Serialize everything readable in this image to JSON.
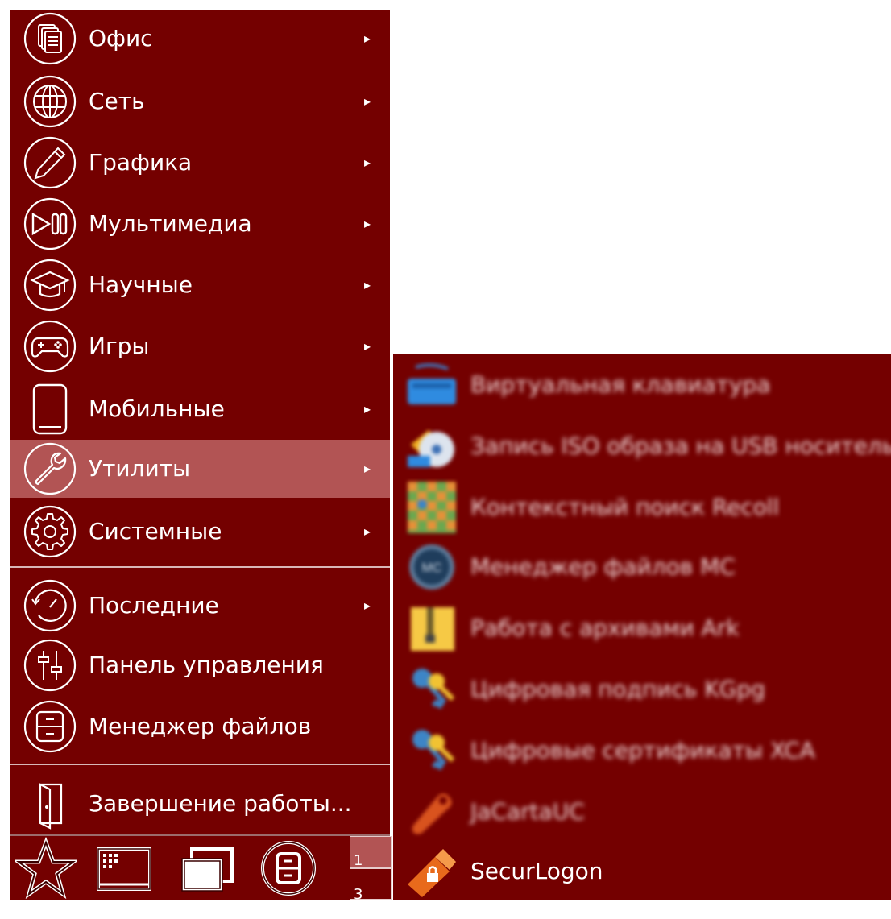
{
  "menu": {
    "items": [
      {
        "label": "Офис",
        "icon": "documents-icon",
        "has_submenu": true
      },
      {
        "label": "Сеть",
        "icon": "globe-icon",
        "has_submenu": true
      },
      {
        "label": "Графика",
        "icon": "pencil-icon",
        "has_submenu": true
      },
      {
        "label": "Мультимедиа",
        "icon": "play-pause-icon",
        "has_submenu": true
      },
      {
        "label": "Научные",
        "icon": "graduation-cap-icon",
        "has_submenu": true
      },
      {
        "label": "Игры",
        "icon": "gamepad-icon",
        "has_submenu": true
      },
      {
        "label": "Мобильные",
        "icon": "tablet-icon",
        "has_submenu": true
      },
      {
        "label": "Утилиты",
        "icon": "wrench-icon",
        "has_submenu": true,
        "active": true
      },
      {
        "label": "Системные",
        "icon": "gear-icon",
        "has_submenu": true
      }
    ],
    "items2": [
      {
        "label": "Последние",
        "icon": "clock-icon",
        "has_submenu": true
      },
      {
        "label": "Панель управления",
        "icon": "sliders-icon",
        "has_submenu": false
      },
      {
        "label": "Менеджер файлов",
        "icon": "cabinet-icon",
        "has_submenu": false
      }
    ],
    "shutdown": {
      "label": "Завершение работы...",
      "icon": "door-exit-icon"
    },
    "arrow_glyph": "▸"
  },
  "taskbar": {
    "buttons": [
      "star-icon",
      "apps-grid-icon",
      "windows-icon",
      "file-manager-icon"
    ],
    "workspaces": [
      "1",
      "3"
    ]
  },
  "submenu": {
    "items": [
      {
        "label": "Виртуальная клавиатура",
        "icon": "keyboard-icon"
      },
      {
        "label": "Запись ISO образа на USB носитель",
        "icon": "usb-disc-icon"
      },
      {
        "label": "Контекстный поиск Recoll",
        "icon": "recoll-icon"
      },
      {
        "label": "Менеджер файлов MC",
        "icon": "mc-icon"
      },
      {
        "label": "Работа с архивами Ark",
        "icon": "archive-icon"
      },
      {
        "label": "Цифровая подпись KGpg",
        "icon": "keys-icon"
      },
      {
        "label": "Цифровые сертификаты XCA",
        "icon": "keys-certificate-icon"
      },
      {
        "label": "JaCartaUC",
        "icon": "token-icon"
      },
      {
        "label": "SecurLogon",
        "icon": "usb-lock-icon"
      }
    ]
  },
  "colors": {
    "menu_bg": "#740000",
    "active_bg": "#b25454",
    "text": "#ffffff",
    "page_bg": "#ffffff"
  }
}
